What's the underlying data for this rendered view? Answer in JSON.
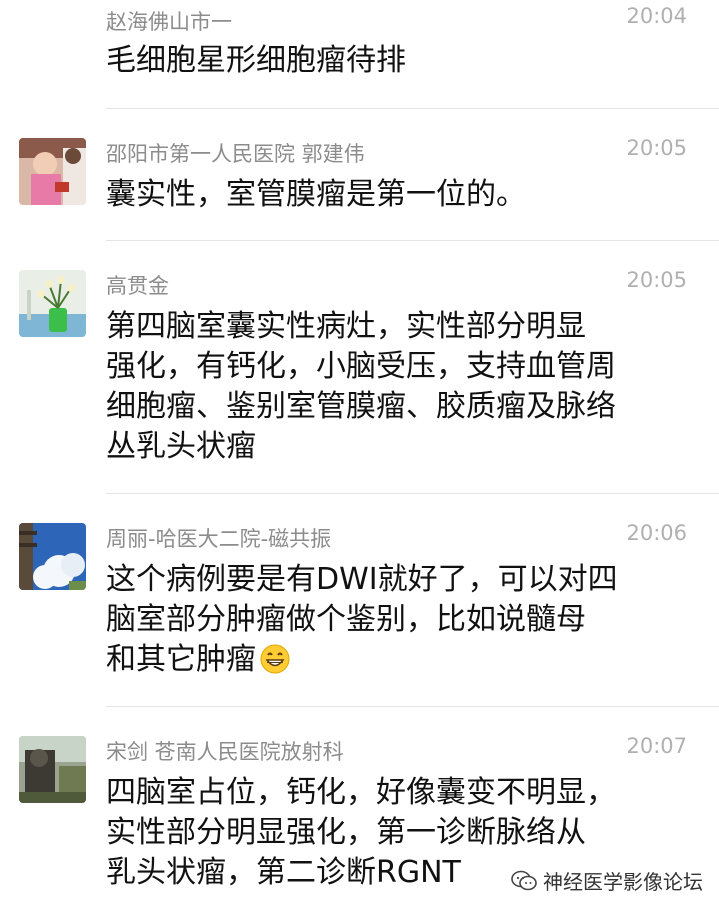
{
  "messages": [
    {
      "sender": "赵海佛山市一",
      "time": "20:04",
      "text": "毛细胞星形细胞瘤待排"
    },
    {
      "sender": "邵阳市第一人民医院  郭建伟",
      "time": "20:05",
      "text": "囊实性，室管膜瘤是第一位的。"
    },
    {
      "sender": "高贯金",
      "time": "20:05",
      "text": "第四脑室囊实性病灶，实性部分明显\n强化，有钙化，小脑受压，支持血管周\n细胞瘤、鉴别室管膜瘤、胶质瘤及脉络\n丛乳头状瘤"
    },
    {
      "sender": "周丽-哈医大二院-磁共振",
      "time": "20:06",
      "text": "这个病例要是有DWI就好了，可以对四\n脑室部分肿瘤做个鉴别，比如说髓母\n和其它肿瘤",
      "emoji": "grinning-face-emoji"
    },
    {
      "sender": "宋剑  苍南人民医院放射科",
      "time": "20:07",
      "text": "四脑室占位，钙化，好像囊变不明显，\n实性部分明显强化，第一诊断脉络从\n乳头状瘤，第二诊断RGNT"
    }
  ],
  "watermark": {
    "text": "神经医学影像论坛",
    "icon": "wechat-icon"
  }
}
